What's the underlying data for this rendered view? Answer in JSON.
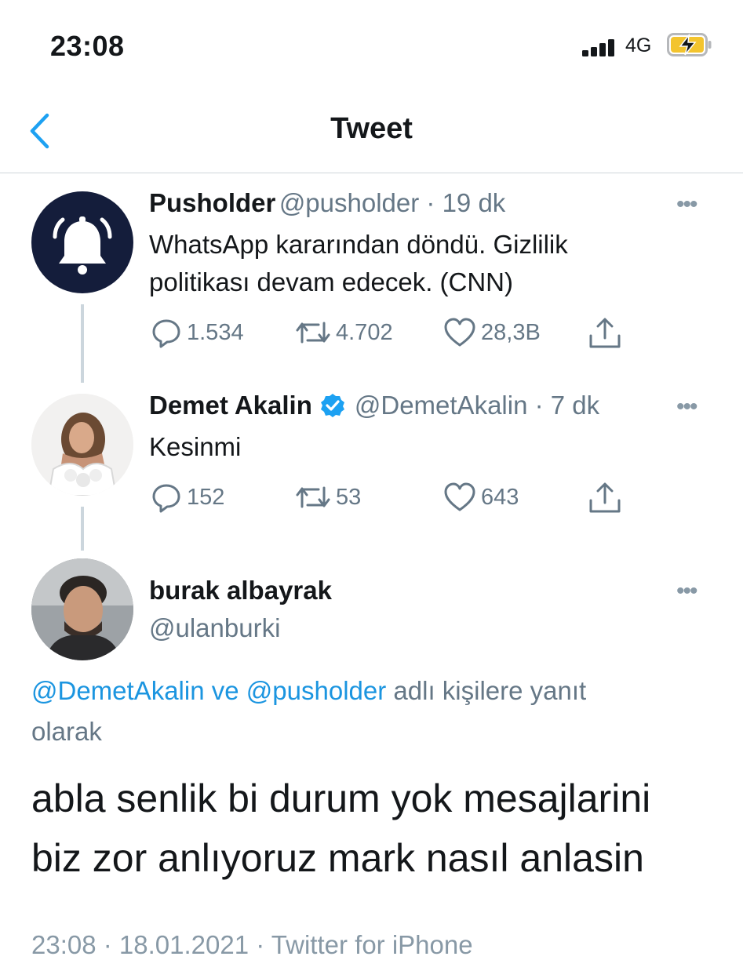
{
  "status_bar": {
    "time": "23:08",
    "network": "4G",
    "icons": [
      "signal-icon",
      "battery-charging-icon"
    ]
  },
  "nav": {
    "title": "Tweet",
    "back_icon": "chevron-left-icon"
  },
  "tweets": [
    {
      "name": "Pusholder",
      "handle": "@pusholder · 19 dk",
      "text_line1": "WhatsApp kararından döndü. Gizlilik",
      "text_line2": "politikası devam edecek. (CNN)",
      "replies": "1.534",
      "retweets": "4.702",
      "likes": "28,3B",
      "avatar_icon": "bell-icon"
    },
    {
      "name": "Demet Akalin",
      "handle": "@DemetAkalin · 7 dk",
      "text": "Kesinmi",
      "replies": "152",
      "retweets": "53",
      "likes": "643",
      "verified_icon": "verified-badge-icon"
    }
  ],
  "main_tweet": {
    "name": "burak albayrak",
    "handle": "@ulanburki",
    "reply_link1": "@DemetAkalin",
    "reply_ve": "ve",
    "reply_link2": "@pusholder",
    "reply_suffix1": "adlı kişilere yanıt",
    "reply_suffix2": "olarak",
    "text_line1": "abla senlik bi durum yok mesajlarini",
    "text_line2": "biz zor anlıyoruz mark nasıl anlasin",
    "meta": "23:08 · 18.01.2021 · Twitter for iPhone"
  },
  "colors": {
    "accent": "#1da1f2",
    "muted": "#657786",
    "dark_avatar": "#141d3b"
  }
}
